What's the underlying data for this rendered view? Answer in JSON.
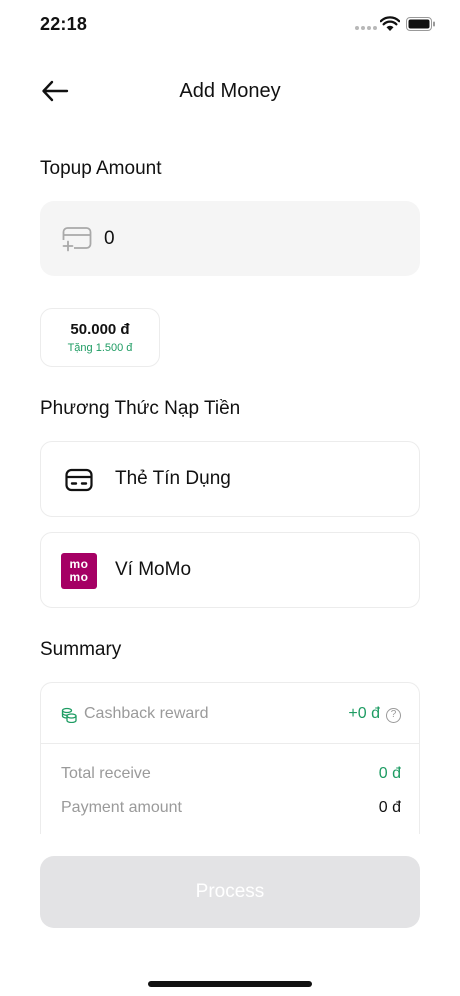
{
  "status_bar": {
    "time": "22:18"
  },
  "nav": {
    "title": "Add Money",
    "back_icon": "arrow-left-icon"
  },
  "topup": {
    "section_title": "Topup Amount",
    "amount_value": "0",
    "input_icon": "card-add-icon"
  },
  "quick_amounts": [
    {
      "value": "50.000 đ",
      "bonus": "Tặng 1.500 đ"
    }
  ],
  "payment": {
    "section_title": "Phương Thức Nạp Tiền",
    "methods": [
      {
        "label": "Thẻ Tín Dụng",
        "icon": "credit-card-icon"
      },
      {
        "label": "Ví MoMo",
        "icon": "momo-logo",
        "logo_line1": "mo",
        "logo_line2": "mo"
      }
    ]
  },
  "summary": {
    "section_title": "Summary",
    "cashback_label": "Cashback reward",
    "cashback_value": "+0 đ",
    "total_receive_label": "Total receive",
    "total_receive_value": "0 đ",
    "payment_amount_label": "Payment amount",
    "payment_amount_value": "0 đ",
    "help_symbol": "?"
  },
  "actions": {
    "process_label": "Process"
  },
  "colors": {
    "accent_green": "#1e9c63",
    "momo_brand": "#a50064",
    "disabled_button": "#e3e3e5"
  }
}
